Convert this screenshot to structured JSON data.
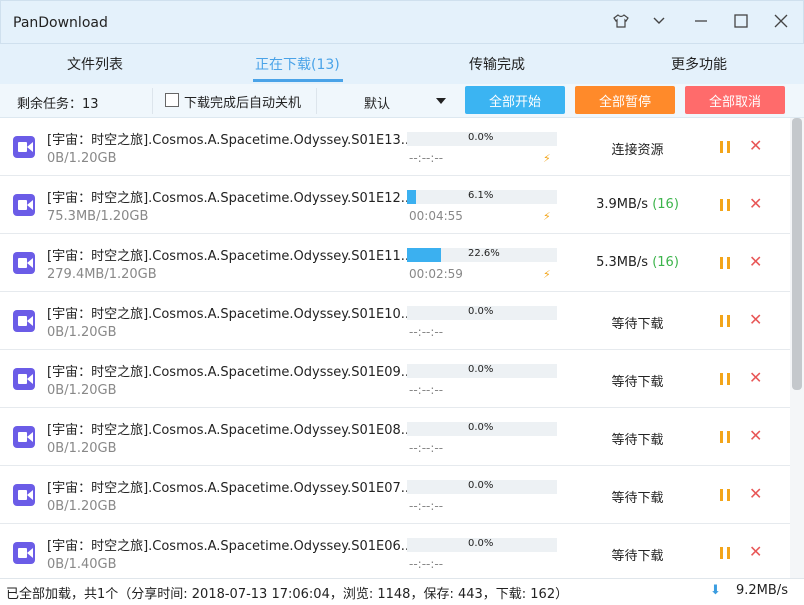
{
  "app": {
    "title": "PanDownload"
  },
  "window_controls": [
    {
      "name": "skin-icon",
      "glyph": "👕"
    },
    {
      "name": "chevron-down-icon",
      "glyph": "⌄"
    },
    {
      "name": "minimize-icon",
      "glyph": "—"
    },
    {
      "name": "maximize-icon",
      "glyph": "☐"
    },
    {
      "name": "close-icon",
      "glyph": "✕"
    }
  ],
  "tabs": [
    {
      "label": "文件列表",
      "active": false
    },
    {
      "label": "正在下载(13)",
      "active": true
    },
    {
      "label": "传输完成",
      "active": false
    },
    {
      "label": "更多功能",
      "active": false
    }
  ],
  "toolbar": {
    "remaining": "剩余任务：13",
    "auto_shutdown_label": "下载完成后自动关机",
    "auto_shutdown_checked": false,
    "sort_select": "默认",
    "start_all": "全部开始",
    "pause_all": "全部暂停",
    "cancel_all": "全部取消",
    "colors": {
      "start": "#3bb4f2",
      "pause": "#ff8a2a",
      "cancel": "#ff6b6b"
    }
  },
  "downloads": [
    {
      "name": "[宇宙：时空之旅].Cosmos.A.Spacetime.Odyssey.S01E13....",
      "size": "0B/1.20GB",
      "progress_pct": 0.0,
      "progress_label": "0.0%",
      "eta": "--:--:--",
      "boost": true,
      "status": "连接资源",
      "connections": ""
    },
    {
      "name": "[宇宙：时空之旅].Cosmos.A.Spacetime.Odyssey.S01E12....",
      "size": "75.3MB/1.20GB",
      "progress_pct": 6.1,
      "progress_label": "6.1%",
      "eta": "00:04:55",
      "boost": true,
      "status": "3.9MB/s",
      "connections": "(16)"
    },
    {
      "name": "[宇宙：时空之旅].Cosmos.A.Spacetime.Odyssey.S01E11....",
      "size": "279.4MB/1.20GB",
      "progress_pct": 22.6,
      "progress_label": "22.6%",
      "eta": "00:02:59",
      "boost": true,
      "status": "5.3MB/s",
      "connections": "(16)"
    },
    {
      "name": "[宇宙：时空之旅].Cosmos.A.Spacetime.Odyssey.S01E10....",
      "size": "0B/1.20GB",
      "progress_pct": 0.0,
      "progress_label": "0.0%",
      "eta": "--:--:--",
      "boost": false,
      "status": "等待下载",
      "connections": ""
    },
    {
      "name": "[宇宙：时空之旅].Cosmos.A.Spacetime.Odyssey.S01E09....",
      "size": "0B/1.20GB",
      "progress_pct": 0.0,
      "progress_label": "0.0%",
      "eta": "--:--:--",
      "boost": false,
      "status": "等待下载",
      "connections": ""
    },
    {
      "name": "[宇宙：时空之旅].Cosmos.A.Spacetime.Odyssey.S01E08....",
      "size": "0B/1.20GB",
      "progress_pct": 0.0,
      "progress_label": "0.0%",
      "eta": "--:--:--",
      "boost": false,
      "status": "等待下载",
      "connections": ""
    },
    {
      "name": "[宇宙：时空之旅].Cosmos.A.Spacetime.Odyssey.S01E07....",
      "size": "0B/1.20GB",
      "progress_pct": 0.0,
      "progress_label": "0.0%",
      "eta": "--:--:--",
      "boost": false,
      "status": "等待下载",
      "connections": ""
    },
    {
      "name": "[宇宙：时空之旅].Cosmos.A.Spacetime.Odyssey.S01E06....",
      "size": "0B/1.40GB",
      "progress_pct": 0.0,
      "progress_label": "0.0%",
      "eta": "--:--:--",
      "boost": false,
      "status": "等待下载",
      "connections": ""
    }
  ],
  "statusbar": {
    "text": "已全部加载，共1个（分享时间: 2018-07-13 17:06:04，浏览: 1148，保存: 443，下载: 162）",
    "speed": "9.2MB/s"
  }
}
